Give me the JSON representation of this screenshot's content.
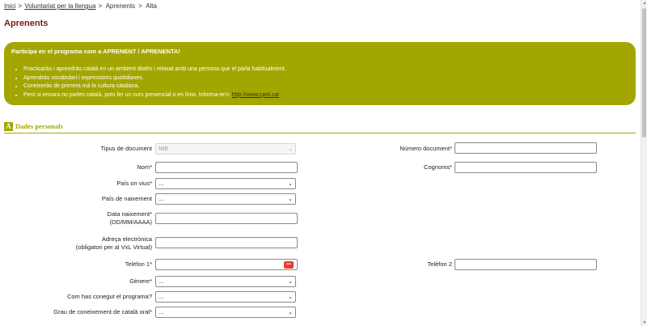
{
  "breadcrumb": {
    "items": [
      "Inici",
      "Voluntariat per la llengua",
      "Aprenents",
      "Alta"
    ],
    "separator": ">"
  },
  "page_title": "Aprenents",
  "callout": {
    "title": "Participa en el programa com a APRENENT / APRENENTA!",
    "bullets": [
      "Practicaràs i aprendràs català en un ambient distès i relaxat amb una persona que el parla habitualment.",
      "Aprendràs vocabulari i expressions quotidianes.",
      "Coneixeràs de primera mà la cultura catalana."
    ],
    "last_bullet_text": "Però si encara no parles català, pots fer un curs presencial o en línia. Informa-te'n: ",
    "last_bullet_link": "http://www.cpnl.cat"
  },
  "section": {
    "letter": "A",
    "title": "Dades personals"
  },
  "form": {
    "tipus_document": {
      "label": "Tipus de document",
      "value": "NIE"
    },
    "numero_document": {
      "label": "Número document*",
      "value": ""
    },
    "nom": {
      "label": "Nom*",
      "value": ""
    },
    "cognoms": {
      "label": "Cognoms*",
      "value": ""
    },
    "pais_on_vius": {
      "label": "País on vius*",
      "value": "..."
    },
    "pais_naixement": {
      "label": "País de naixement",
      "value": "..."
    },
    "data_naixement": {
      "label_line1": "Data naixement*",
      "label_line2": "(DD/MM/AAAA)",
      "value": ""
    },
    "email": {
      "label_line1": "Adreça electrònica",
      "label_line2": "(obligatori per al VxL Virtual)",
      "value": ""
    },
    "telefon1": {
      "label": "Telèfon 1*",
      "value": "",
      "badge": "•••"
    },
    "telefon2": {
      "label": "Telèfon 2",
      "value": ""
    },
    "genere": {
      "label": "Gènere*",
      "value": "..."
    },
    "com_has_conegut": {
      "label": "Com has conegut el programa?",
      "value": "..."
    },
    "grau_catala_oral": {
      "label": "Grau de coneixement de català oral*",
      "value": "..."
    }
  },
  "icons": {
    "select_caret": "chevron-down",
    "scroll_up": "▲",
    "scroll_down": "▼"
  },
  "colors": {
    "accent": "#a4a600",
    "title": "#7a1a10",
    "badge": "#e04030"
  }
}
